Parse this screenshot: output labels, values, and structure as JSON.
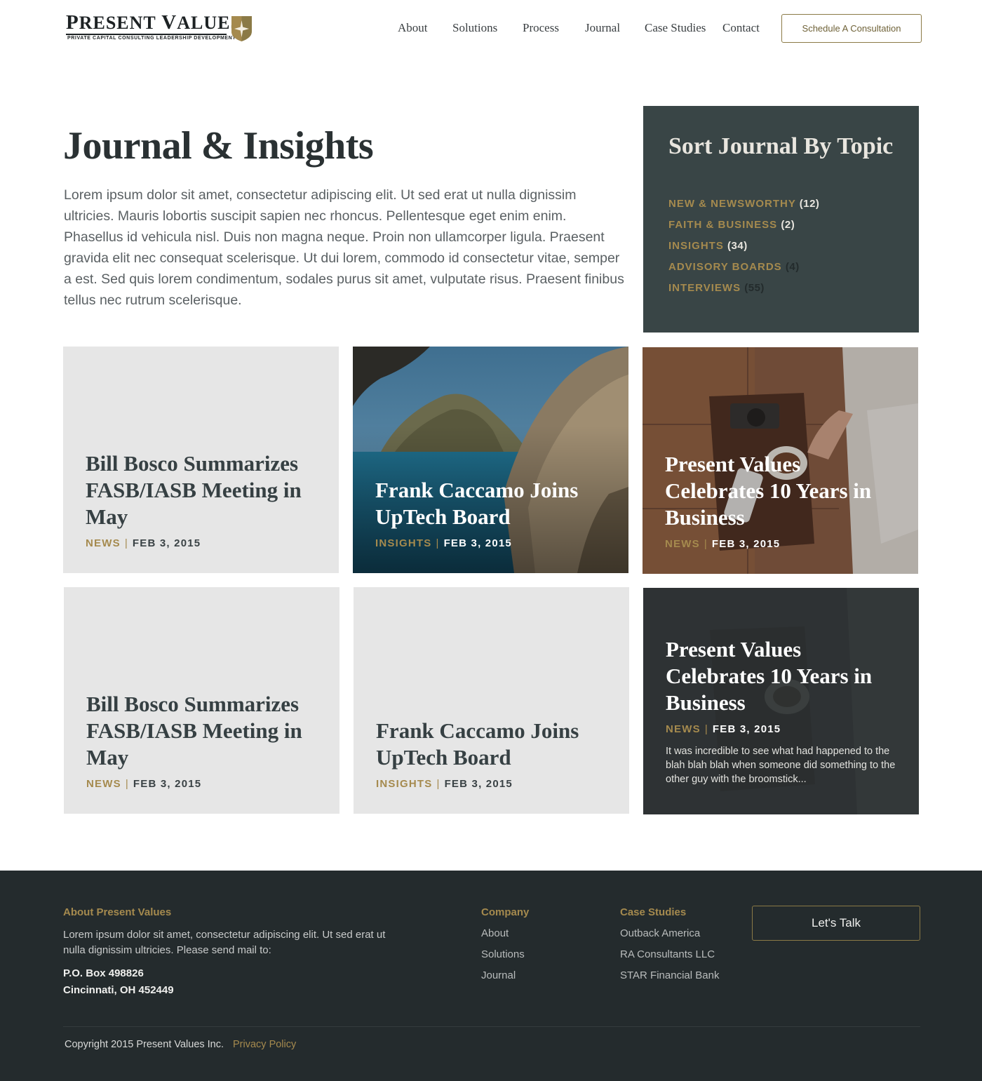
{
  "brand": {
    "name_first": "P",
    "name_first_rest": "RESENT",
    "name_second": "V",
    "name_second_rest": "ALUES",
    "tagline": "PRIVATE CAPITAL   CONSULTING   LEADERSHIP DEVELOPMENT",
    "accent": "#a58a4e",
    "dark": "#242b2d"
  },
  "nav": {
    "items": [
      "About",
      "Solutions",
      "Process",
      "Journal",
      "Case Studies",
      "Contact"
    ],
    "cta": "Schedule A Consultation"
  },
  "intro": {
    "title": "Journal & Insights",
    "body": "Lorem ipsum dolor sit amet, consectetur adipiscing elit. Ut sed erat ut nulla dignissim ultricies. Mauris lobortis suscipit sapien nec rhoncus. Pellentesque eget enim enim. Phasellus id vehicula nisl. Duis non magna neque. Proin non ullamcorper ligula. Praesent gravida elit nec consequat scelerisque. Ut dui lorem, commodo id consectetur vitae, semper a est. Sed quis lorem condimentum, sodales purus sit amet, vulputate risus. Praesent finibus tellus nec rutrum scelerisque."
  },
  "topics": {
    "title": "Sort Journal By Topic",
    "items": [
      {
        "name": "NEW & NEWSWORTHY",
        "count": "(12)"
      },
      {
        "name": "FAITH & BUSINESS",
        "count": "(2)"
      },
      {
        "name": "INSIGHTS",
        "count": "(34)"
      },
      {
        "name": "ADVISORY BOARDS",
        "count": "(4)"
      },
      {
        "name": "INTERVIEWS",
        "count": "(55)"
      }
    ]
  },
  "cards": [
    {
      "title": "Bill Bosco Summarizes FASB/IASB Meeting in May",
      "category": "NEWS",
      "date": "FEB 3, 2015"
    },
    {
      "title": "Frank Caccamo Joins UpTech Board",
      "category": "INSIGHTS",
      "date": "FEB 3, 2015"
    },
    {
      "title": "Present Values Celebrates 10 Years in Business",
      "category": "NEWS",
      "date": "FEB 3, 2015"
    },
    {
      "title": "Bill Bosco Summarizes FASB/IASB Meeting in May",
      "category": "NEWS",
      "date": "FEB 3, 2015"
    },
    {
      "title": "Frank Caccamo Joins UpTech Board",
      "category": "INSIGHTS",
      "date": "FEB 3, 2015"
    },
    {
      "title": "Present Values Celebrates 10 Years in Business",
      "category": "NEWS",
      "date": "FEB 3, 2015",
      "excerpt": "It was incredible to see what had happened to the blah blah blah when someone did something to the other guy with the broomstick..."
    }
  ],
  "meta_separator": "|",
  "footer": {
    "about_heading": "About Present Values",
    "about_text": "Lorem ipsum dolor sit amet, consectetur adipiscing elit. Ut sed erat ut nulla dignissim ultricies. Please send mail to:",
    "address_line1": "P.O. Box 498826",
    "address_line2": "Cincinnati, OH 452449",
    "company_heading": "Company",
    "company_links": [
      "About",
      "Solutions",
      "Journal"
    ],
    "cases_heading": "Case Studies",
    "cases_links": [
      "Outback America",
      "RA Consultants LLC",
      "STAR Financial Bank"
    ],
    "cta": "Let's Talk",
    "copyright": "Copyright 2015 Present Values Inc.",
    "privacy": "Privacy Policy"
  }
}
